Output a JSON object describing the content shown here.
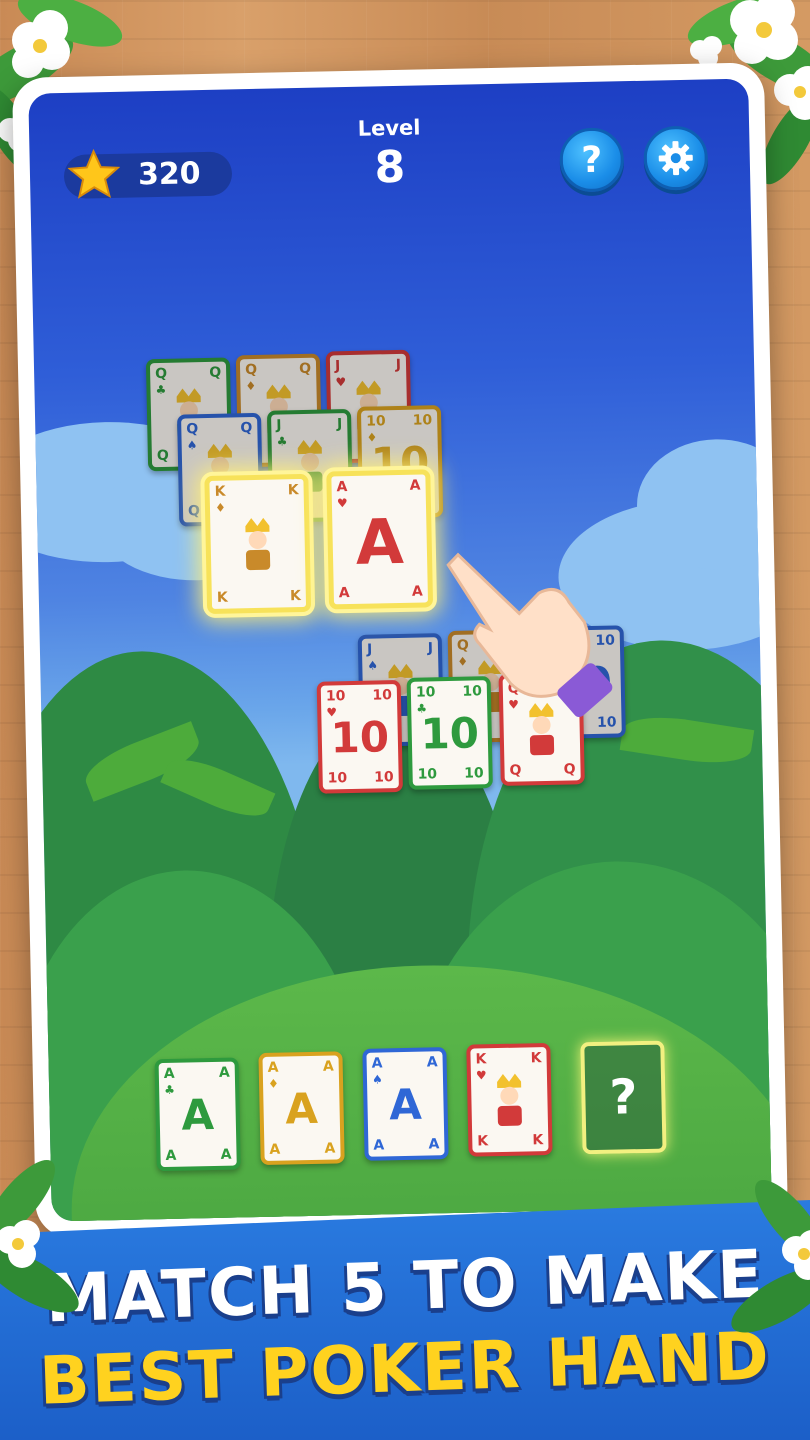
{
  "hud": {
    "score": "320",
    "level_label": "Level",
    "level_number": "8",
    "help_label": "?",
    "settings_icon": "gear-icon",
    "star_icon": "star-icon"
  },
  "board": {
    "back_row": [
      {
        "rank": "Q",
        "suit": "♣",
        "color": "#2e9a3e"
      },
      {
        "rank": "Q",
        "suit": "♦",
        "color": "#c98a2a"
      },
      {
        "rank": "J",
        "suit": "♥",
        "color": "#d23a3a"
      }
    ],
    "mid_row": [
      {
        "rank": "Q",
        "suit": "♠",
        "color": "#2f67d6"
      },
      {
        "rank": "J",
        "suit": "♣",
        "color": "#2e9a3e"
      },
      {
        "rank": "10",
        "suit": "♦",
        "color": "#d9a21f"
      }
    ],
    "selected": [
      {
        "rank": "K",
        "suit": "♦",
        "color": "#c98a2a"
      },
      {
        "rank": "A",
        "suit": "♥",
        "color": "#d23a3a"
      }
    ],
    "lower_back": [
      {
        "rank": "J",
        "suit": "♠",
        "color": "#2f67d6"
      },
      {
        "rank": "Q",
        "suit": "♦",
        "color": "#c98a2a"
      },
      {
        "rank": "10",
        "suit": "♠",
        "color": "#2f67d6"
      }
    ],
    "lower_front": [
      {
        "rank": "10",
        "suit": "♥",
        "color": "#d23a3a"
      },
      {
        "rank": "10",
        "suit": "♣",
        "color": "#2e9a3e"
      },
      {
        "rank": "Q",
        "suit": "♥",
        "color": "#d23a3a"
      }
    ]
  },
  "hand": {
    "cards": [
      {
        "rank": "A",
        "suit": "♣",
        "color": "#2e9a3e"
      },
      {
        "rank": "A",
        "suit": "♦",
        "color": "#d9a21f"
      },
      {
        "rank": "A",
        "suit": "♠",
        "color": "#2f67d6"
      },
      {
        "rank": "K",
        "suit": "♥",
        "color": "#d23a3a"
      }
    ],
    "empty_slot_label": "?"
  },
  "banner": {
    "line1": "MATCH 5 TO MAKE",
    "line2": "BEST POKER HAND"
  }
}
